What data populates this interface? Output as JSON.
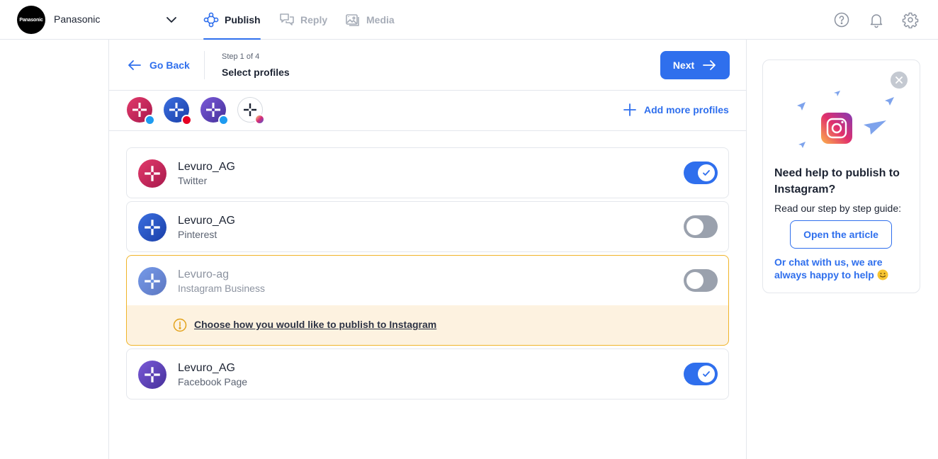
{
  "brand": {
    "logo_text": "Panasonic",
    "name": "Panasonic"
  },
  "nav": {
    "tabs": [
      {
        "label": "Publish",
        "icon": "publish-icon",
        "active": true
      },
      {
        "label": "Reply",
        "icon": "reply-icon",
        "active": false
      },
      {
        "label": "Media",
        "icon": "media-icon",
        "active": false
      }
    ],
    "right_icons": [
      "help-icon",
      "bell-icon",
      "gear-icon"
    ]
  },
  "stepbar": {
    "back_label": "Go Back",
    "step_count": "Step 1 of 4",
    "step_title": "Select profiles",
    "next_label": "Next"
  },
  "profile_strip": {
    "avatars": [
      {
        "network": "twitter",
        "color": "#d12a5f"
      },
      {
        "network": "pinterest",
        "color": "#2050c8"
      },
      {
        "network": "twitter",
        "color": "#5b3fb5"
      },
      {
        "network": "instagram",
        "color": "#ffffff"
      }
    ],
    "add_more_label": "Add more profiles"
  },
  "profiles": [
    {
      "name": "Levuro_AG",
      "network": "Twitter",
      "enabled": true,
      "color": "#c8235c"
    },
    {
      "name": "Levuro_AG",
      "network": "Pinterest",
      "enabled": false,
      "color": "#1f4fc6"
    },
    {
      "name": "Levuro-ag",
      "network": "Instagram Business",
      "enabled": false,
      "color": "#2c63d6"
    },
    {
      "name": "Levuro_AG",
      "network": "Facebook Page",
      "enabled": true,
      "color": "#5a3db3"
    }
  ],
  "warning": {
    "text": "Choose how you would like to publish to Instagram"
  },
  "help": {
    "title": "Need help to publish to Instagram?",
    "subtitle": "Read our step by step guide:",
    "button_label": "Open the article",
    "chat_text": "Or chat with us, we are always happy to help"
  },
  "colors": {
    "accent": "#2f6fed",
    "warning_border": "#f0b429",
    "warning_bg": "#fdf2e0",
    "toggle_off": "#9aa1ad"
  }
}
